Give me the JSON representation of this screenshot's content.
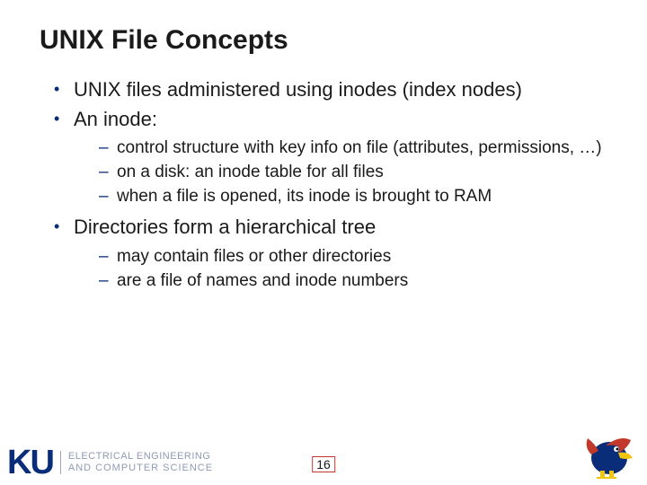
{
  "title": "UNIX File Concepts",
  "bullets": {
    "b1": "UNIX files administered using inodes (index nodes)",
    "b2": "An inode:",
    "b2_sub": {
      "s1": "control structure with key info on file (attributes, permissions, …)",
      "s2": "on a disk:  an inode table for all files",
      "s3": "when a file is opened, its inode is brought to RAM"
    },
    "b3": "Directories form a hierarchical tree",
    "b3_sub": {
      "s1": "may contain files or other directories",
      "s2": "are a file of names and inode numbers"
    }
  },
  "footer": {
    "ku": "KU",
    "dept_line1": "ELECTRICAL ENGINEERING",
    "dept_line2": "AND COMPUTER SCIENCE",
    "page": "16"
  }
}
